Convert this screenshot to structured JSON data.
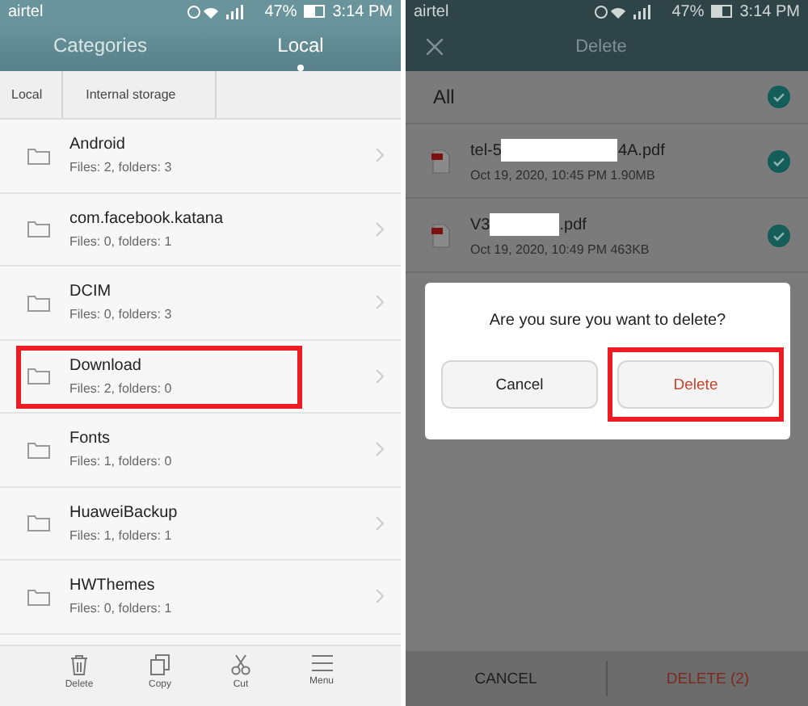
{
  "left_screen": {
    "status_bar": {
      "carrier": "airtel",
      "battery": "47%",
      "time": "3:14 PM"
    },
    "tabs": [
      {
        "label": "Categories",
        "selected": false
      },
      {
        "label": "Local",
        "selected": true
      }
    ],
    "breadcrumb": [
      "Local",
      "Internal storage"
    ],
    "folders": [
      {
        "name": "Android",
        "details": "Files: 2, folders: 3",
        "highlighted": false
      },
      {
        "name": "com.facebook.katana",
        "details": "Files: 0, folders: 1",
        "highlighted": false
      },
      {
        "name": "DCIM",
        "details": "Files: 0, folders: 3",
        "highlighted": false
      },
      {
        "name": "Download",
        "details": "Files: 2, folders: 0",
        "highlighted": true
      },
      {
        "name": "Fonts",
        "details": "Files: 1, folders: 0",
        "highlighted": false
      },
      {
        "name": "HuaweiBackup",
        "details": "Files: 1, folders: 1",
        "highlighted": false
      },
      {
        "name": "HWThemes",
        "details": "Files: 0, folders: 1",
        "highlighted": false
      }
    ],
    "toolbar": [
      {
        "kind": "delete",
        "label": "Delete"
      },
      {
        "kind": "copy",
        "label": "Copy"
      },
      {
        "kind": "cut",
        "label": "Cut"
      },
      {
        "kind": "menu",
        "label": "Menu"
      }
    ]
  },
  "right_screen": {
    "status_bar": {
      "carrier": "airtel",
      "battery": "47%",
      "time": "3:14 PM"
    },
    "title": "Delete",
    "all_row": {
      "label": "All",
      "checked": true
    },
    "files": [
      {
        "name_start": "tel-5",
        "name_end": "4A.pdf",
        "details": "Oct 19, 2020, 10:45 PM 1.90MB",
        "checked": true
      },
      {
        "name_start": "V3",
        "name_end": ".pdf",
        "details": "Oct 19, 2020, 10:49 PM 463KB",
        "checked": true
      }
    ],
    "dialog": {
      "message": "Are you sure you want to delete?",
      "buttons": [
        {
          "label": "Cancel",
          "kind": "cancel",
          "highlighted": false
        },
        {
          "label": "Delete",
          "kind": "danger",
          "highlighted": true
        }
      ]
    },
    "bottom_actions": [
      {
        "label": "CANCEL",
        "kind": "cancel"
      },
      {
        "label": "DELETE (2)",
        "kind": "danger"
      }
    ]
  }
}
